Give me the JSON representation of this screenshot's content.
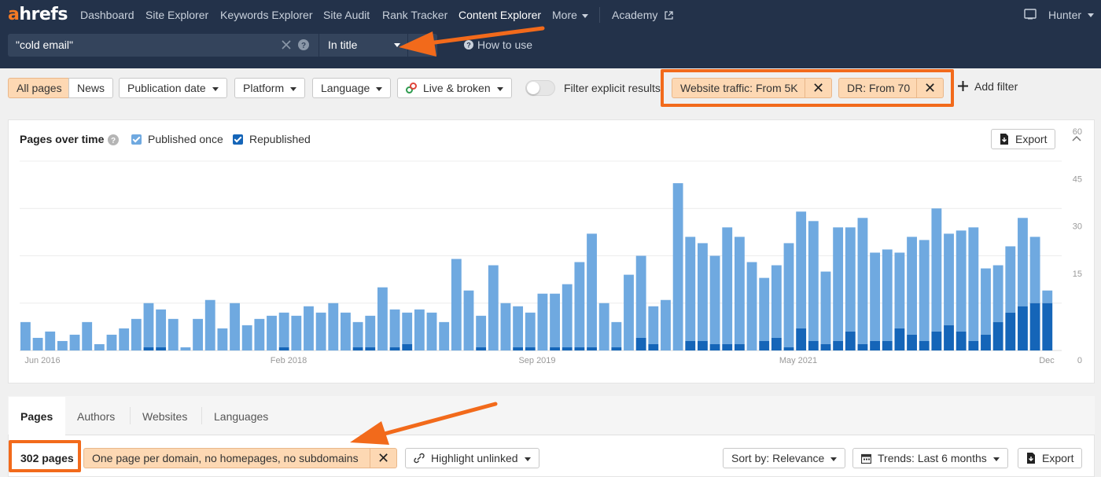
{
  "nav": {
    "logo_a": "a",
    "logo_rest": "hrefs",
    "items": [
      "Dashboard",
      "Site Explorer",
      "Keywords Explorer",
      "Site Audit",
      "Rank Tracker",
      "Content Explorer",
      "More",
      "Academy"
    ],
    "user": "Hunter"
  },
  "search": {
    "query": "\"cold email\"",
    "mode": "In title",
    "how_to_use": "How to use"
  },
  "filters": {
    "all_pages": "All pages",
    "news": "News",
    "publication_date": "Publication date",
    "platform": "Platform",
    "language": "Language",
    "live_broken": "Live & broken",
    "filter_explicit": "Filter explicit results",
    "website_traffic": "Website traffic: From 5K",
    "dr": "DR: From 70",
    "add_filter": "Add filter"
  },
  "chart_panel": {
    "title": "Pages over time",
    "legend_once": "Published once",
    "legend_republished": "Republished",
    "export": "Export"
  },
  "chart_data": {
    "type": "bar",
    "stacked": true,
    "x_tick_labels": [
      "Jun 2016",
      "Feb 2018",
      "Sep 2019",
      "May 2021",
      "Dec"
    ],
    "y_ticks": [
      0,
      15,
      30,
      45,
      60
    ],
    "ylim": [
      0,
      60
    ],
    "grid": true,
    "colors": {
      "published_once": "#6fa9e0",
      "republished": "#1565b8"
    },
    "series": [
      {
        "name": "Published once",
        "values": [
          9,
          4,
          6,
          3,
          5,
          9,
          2,
          5,
          7,
          10,
          14,
          12,
          10,
          1,
          10,
          16,
          7,
          15,
          8,
          10,
          11,
          11,
          11,
          14,
          12,
          15,
          12,
          8,
          10,
          20,
          12,
          10,
          13,
          12,
          9,
          29,
          19,
          10,
          27,
          15,
          13,
          11,
          18,
          17,
          20,
          27,
          36,
          15,
          8,
          24,
          26,
          12,
          16,
          53,
          33,
          31,
          28,
          37,
          34,
          28,
          20,
          23,
          33,
          37,
          38,
          23,
          36,
          33,
          40,
          28,
          29,
          24,
          31,
          32,
          39,
          29,
          32,
          36,
          21,
          18,
          21,
          28,
          21,
          4
        ]
      },
      {
        "name": "Republished",
        "values": [
          0,
          0,
          0,
          0,
          0,
          0,
          0,
          0,
          0,
          0,
          1,
          1,
          0,
          0,
          0,
          0,
          0,
          0,
          0,
          0,
          0,
          1,
          0,
          0,
          0,
          0,
          0,
          1,
          1,
          0,
          1,
          2,
          0,
          0,
          0,
          0,
          0,
          1,
          0,
          0,
          1,
          1,
          0,
          1,
          1,
          1,
          1,
          0,
          1,
          0,
          4,
          2,
          0,
          0,
          3,
          3,
          2,
          2,
          2,
          0,
          3,
          4,
          1,
          7,
          3,
          2,
          3,
          6,
          2,
          3,
          3,
          7,
          5,
          3,
          6,
          8,
          6,
          3,
          5,
          9,
          12,
          14,
          15,
          15
        ]
      }
    ]
  },
  "results": {
    "tabs": [
      "Pages",
      "Authors",
      "Websites",
      "Languages"
    ],
    "count": "302 pages",
    "dedupe_chip": "One page per domain, no homepages, no subdomains",
    "highlight_unlinked": "Highlight unlinked",
    "sort_by": "Sort by: Relevance",
    "trends": "Trends: Last 6 months",
    "export": "Export"
  },
  "annotation_color": "#f26a1b"
}
